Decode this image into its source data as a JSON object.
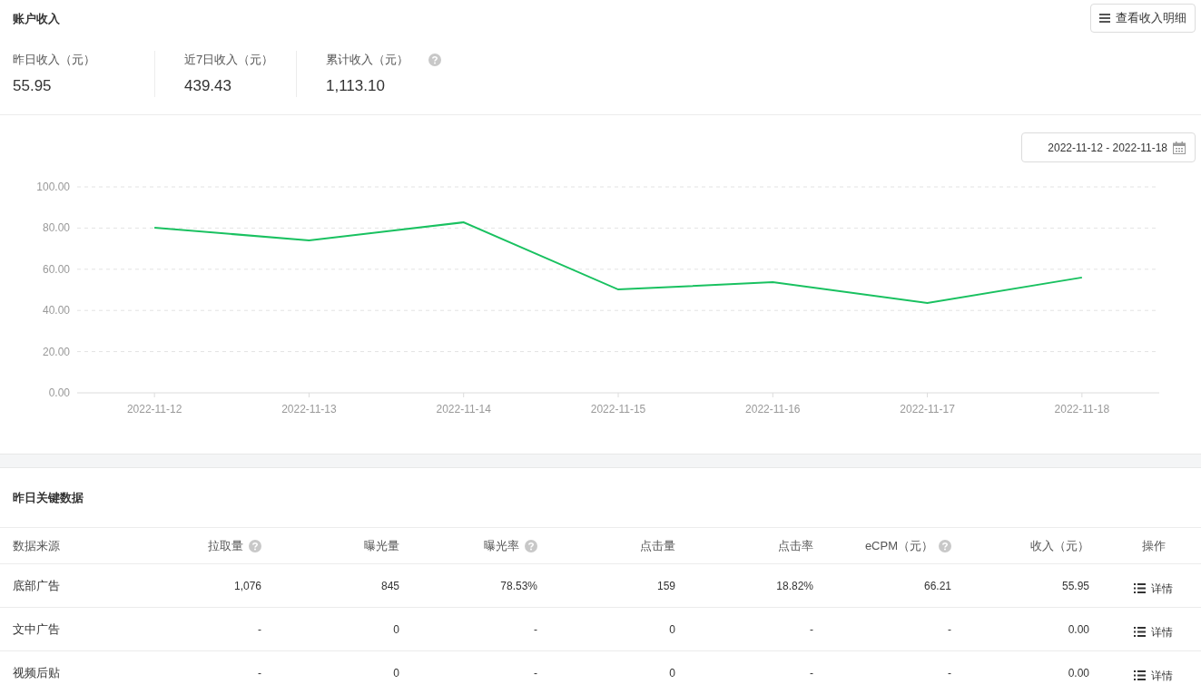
{
  "header": {
    "title": "账户收入",
    "detail_button": "查看收入明细"
  },
  "stats": [
    {
      "label": "昨日收入（元）",
      "value": "55.95",
      "help": false
    },
    {
      "label": "近7日收入（元）",
      "value": "439.43",
      "help": false
    },
    {
      "label": "累计收入（元）",
      "value": "1,113.10",
      "help": true
    }
  ],
  "date_range": "2022-11-12 - 2022-11-18",
  "chart_data": {
    "type": "line",
    "categories": [
      "2022-11-12",
      "2022-11-13",
      "2022-11-14",
      "2022-11-15",
      "2022-11-16",
      "2022-11-17",
      "2022-11-18"
    ],
    "series": [
      {
        "color": "#19c160",
        "values": [
          80.2,
          74.0,
          82.8,
          50.2,
          53.7,
          43.6,
          56.0
        ]
      }
    ],
    "grid": true,
    "ylim": [
      0,
      100
    ],
    "yticks": [
      {
        "value": 0,
        "label": "0.00"
      },
      {
        "value": 20,
        "label": "20.00"
      },
      {
        "value": 40,
        "label": "40.00"
      },
      {
        "value": 60,
        "label": "60.00"
      },
      {
        "value": 80,
        "label": "80.00"
      },
      {
        "value": 100,
        "label": "100.00"
      }
    ]
  },
  "table": {
    "title": "昨日关键数据",
    "columns": [
      {
        "label": "数据来源",
        "help": false
      },
      {
        "label": "拉取量",
        "help": true
      },
      {
        "label": "曝光量",
        "help": false
      },
      {
        "label": "曝光率",
        "help": true
      },
      {
        "label": "点击量",
        "help": false
      },
      {
        "label": "点击率",
        "help": false
      },
      {
        "label": "eCPM（元）",
        "help": true
      },
      {
        "label": "收入（元）",
        "help": false
      },
      {
        "label": "操作",
        "help": false
      }
    ],
    "rows": [
      {
        "cells": [
          "底部广告",
          "1,076",
          "845",
          "78.53%",
          "159",
          "18.82%",
          "66.21",
          "55.95"
        ],
        "action": "详情"
      },
      {
        "cells": [
          "文中广告",
          "-",
          "0",
          "-",
          "0",
          "-",
          "-",
          "0.00"
        ],
        "action": "详情"
      },
      {
        "cells": [
          "视频后贴",
          "-",
          "0",
          "-",
          "0",
          "-",
          "-",
          "0.00"
        ],
        "action": "详情"
      }
    ]
  }
}
